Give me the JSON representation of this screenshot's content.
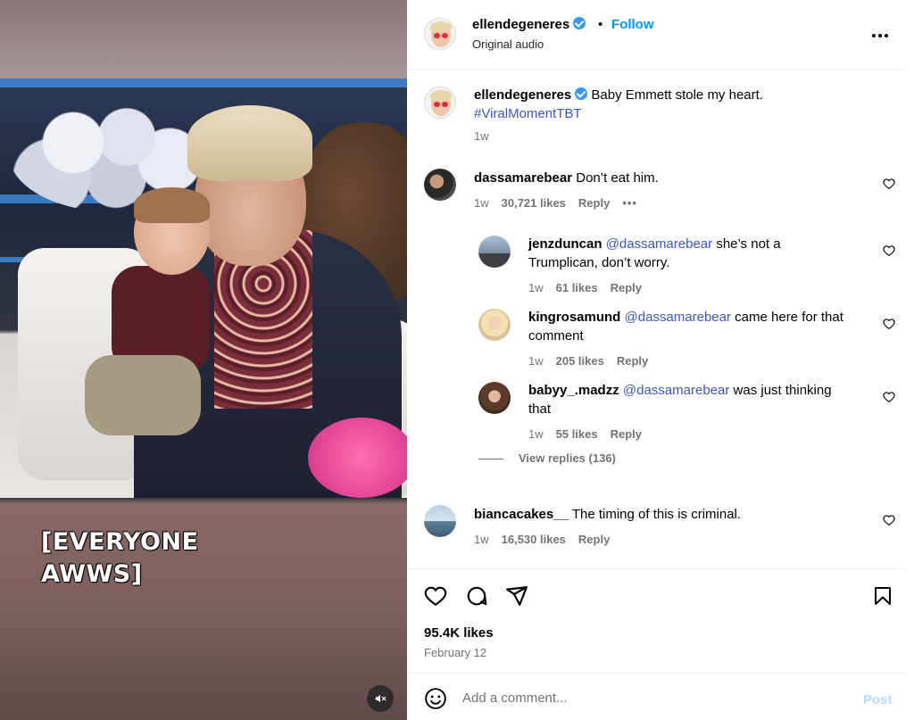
{
  "video": {
    "caption": "[EVERYONE\nAWWS]",
    "mute_icon": "speaker-muted-icon"
  },
  "post": {
    "username": "ellendegeneres",
    "verified": true,
    "separator": "•",
    "follow_label": "Follow",
    "audio_label": "Original audio",
    "more_icon": "more-options-icon",
    "more_label": "•••",
    "caption_text": "Baby Emmett stole my heart.",
    "hashtag": "#ViralMomentTBT",
    "caption_time": "1w"
  },
  "comments": [
    {
      "username": "dassamarebear",
      "mention": "",
      "text": "Don’t eat him.",
      "time": "1w",
      "likes": "30,721 likes",
      "reply_label": "Reply",
      "more_label": "•••",
      "replies": [
        {
          "username": "jenzduncan",
          "mention": "@dassamarebear",
          "text": "she’s not a",
          "text2": "Trumplican, don’t worry.",
          "time": "1w",
          "likes": "61 likes",
          "reply_label": "Reply"
        },
        {
          "username": "kingrosamund",
          "mention": "@dassamarebear",
          "text": "came here for that",
          "text2": "comment",
          "time": "1w",
          "likes": "205 likes",
          "reply_label": "Reply"
        },
        {
          "username": "babyy_.madzz",
          "mention": "@dassamarebear",
          "text": "was just thinking",
          "text2": "that",
          "time": "1w",
          "likes": "55 likes",
          "reply_label": "Reply"
        }
      ],
      "view_replies": "View replies (136)"
    },
    {
      "username": "biancacakes__",
      "text": "The timing of this is criminal.",
      "time": "1w",
      "likes": "16,530 likes",
      "reply_label": "Reply"
    }
  ],
  "actions": {
    "icons": [
      "heart-icon",
      "comment-icon",
      "share-icon",
      "bookmark-icon"
    ],
    "likes": "95.4K likes",
    "date": "February 12"
  },
  "comment_box": {
    "emoji_icon": "emoji-icon",
    "placeholder": "Add a comment...",
    "post_label": "Post"
  },
  "colors": {
    "link_blue": "#0095f6",
    "mention_blue": "#3a57c4",
    "muted_gray": "#737373"
  }
}
